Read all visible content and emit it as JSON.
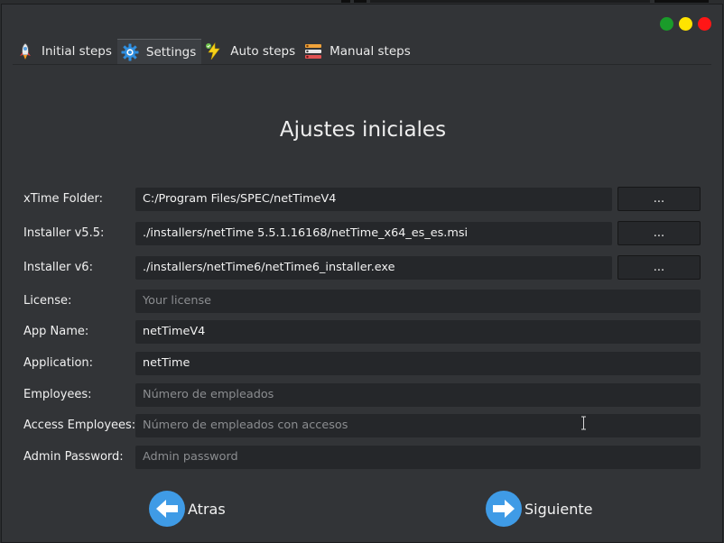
{
  "tabs": [
    {
      "label": "Initial steps",
      "icon": "rocket-icon"
    },
    {
      "label": "Settings",
      "icon": "gear-icon"
    },
    {
      "label": "Auto steps",
      "icon": "lightning-icon"
    },
    {
      "label": "Manual steps",
      "icon": "checklist-icon"
    }
  ],
  "active_tab": "Settings",
  "window_controls": {
    "colors": [
      "#1a9b2a",
      "#ffe300",
      "#ff1616"
    ]
  },
  "page_title": "Ajustes iniciales",
  "form": {
    "xtime_folder": {
      "label": "xTime Folder:",
      "value": "C:/Program Files/SPEC/netTimeV4",
      "browse": "..."
    },
    "installer_v55": {
      "label": "Installer v5.5:",
      "value": "./installers/netTime 5.5.1.16168/netTime_x64_es_es.msi",
      "browse": "..."
    },
    "installer_v6": {
      "label": "Installer v6:",
      "value": "./installers/netTime6/netTime6_installer.exe",
      "browse": "..."
    },
    "license": {
      "label": "License:",
      "placeholder": "Your license"
    },
    "app_name": {
      "label": "App Name:",
      "value": "netTimeV4"
    },
    "application": {
      "label": "Application:",
      "value": "netTime"
    },
    "employees": {
      "label": "Employees:",
      "placeholder": "Número de empleados"
    },
    "access_employees": {
      "label": "Access Employees:",
      "placeholder": "Número de empleados con accesos"
    },
    "admin_password": {
      "label": "Admin Password:",
      "placeholder": "Admin password"
    }
  },
  "nav": {
    "back_label": "Atras",
    "next_label": "Siguiente",
    "accent": "#3f9be6"
  }
}
